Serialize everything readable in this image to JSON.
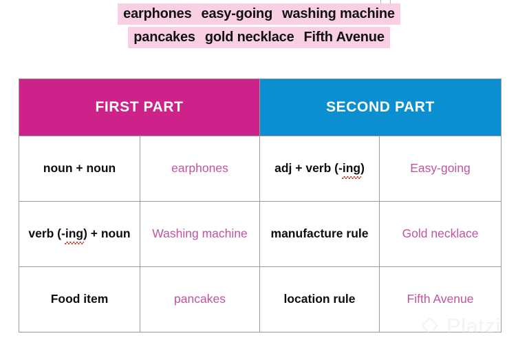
{
  "word_bank": {
    "lines": [
      [
        "earphones",
        "easy-going",
        "washing machine"
      ],
      [
        "pancakes",
        "gold necklace",
        "Fifth Avenue"
      ]
    ],
    "highlight_color": "#f9cfe4"
  },
  "table": {
    "headers": [
      {
        "label": "FIRST PART",
        "color": "#cc2289"
      },
      {
        "label": "SECOND PART",
        "color": "#0b8fd0"
      }
    ],
    "example_text_color": "#c0539f",
    "rows": [
      {
        "first_rule_pre": "noun + noun",
        "first_rule_squiggle": "",
        "first_rule_post": "",
        "first_example": "earphones",
        "second_rule_pre": "adj + verb (-",
        "second_rule_squiggle": "ing",
        "second_rule_post": ")",
        "second_example": "Easy-going"
      },
      {
        "first_rule_pre": "verb (-",
        "first_rule_squiggle": "ing",
        "first_rule_post": ") + noun",
        "first_example": "Washing machine",
        "second_rule_pre": "manufacture rule",
        "second_rule_squiggle": "",
        "second_rule_post": "",
        "second_example": "Gold necklace"
      },
      {
        "first_rule_pre": "Food item",
        "first_rule_squiggle": "",
        "first_rule_post": "",
        "first_example": "pancakes",
        "second_rule_pre": "location rule",
        "second_rule_squiggle": "",
        "second_rule_post": "",
        "second_example": "Fifth Avenue"
      }
    ]
  },
  "watermark": {
    "text": "Platzi"
  }
}
